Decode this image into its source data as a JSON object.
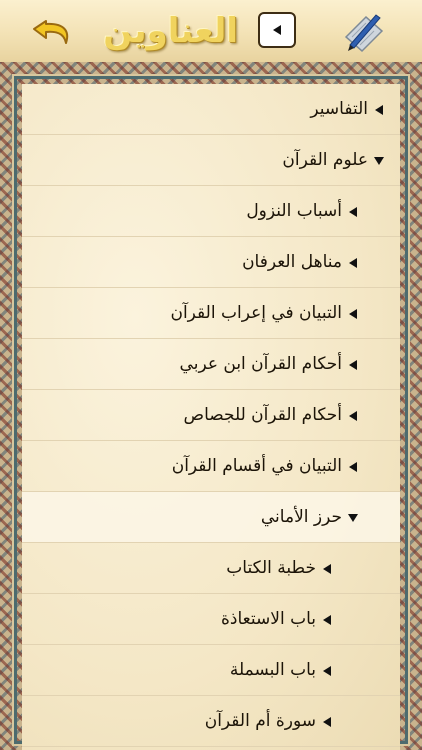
{
  "header": {
    "title": "العناوين",
    "back_icon": "undo-arrow-icon",
    "toggle_icon": "triangle-left-icon",
    "tool_icon": "pen-paper-icon",
    "title_color": "#f0d35e"
  },
  "tree": [
    {
      "label": "التفاسير",
      "level": 0,
      "expanded": false
    },
    {
      "label": "علوم القرآن",
      "level": 0,
      "expanded": true
    },
    {
      "label": "أسباب النزول",
      "level": 1,
      "expanded": false
    },
    {
      "label": "مناهل العرفان",
      "level": 1,
      "expanded": false
    },
    {
      "label": "التبيان في إعراب القرآن",
      "level": 1,
      "expanded": false
    },
    {
      "label": "أحكام القرآن ابن عربي",
      "level": 1,
      "expanded": false
    },
    {
      "label": "أحكام القرآن للجصاص",
      "level": 1,
      "expanded": false
    },
    {
      "label": "التبيان في أقسام القرآن",
      "level": 1,
      "expanded": false
    },
    {
      "label": "حرز الأماني",
      "level": 1,
      "expanded": true,
      "highlighted": true
    },
    {
      "label": "خطبة الكتاب",
      "level": 2,
      "expanded": false
    },
    {
      "label": "باب الاستعاذة",
      "level": 2,
      "expanded": false
    },
    {
      "label": "باب البسملة",
      "level": 2,
      "expanded": false
    },
    {
      "label": "سورة أم القرآن",
      "level": 2,
      "expanded": false
    }
  ]
}
